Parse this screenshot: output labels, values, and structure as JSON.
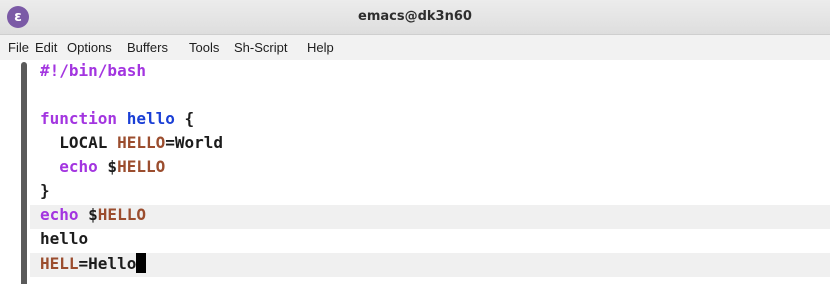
{
  "window": {
    "title": "emacs@dk3n60",
    "app_icon": "emacs-icon",
    "app_icon_glyph": "ε"
  },
  "menu": [
    "File",
    "Edit",
    "Options",
    "Buffers",
    "Tools",
    "Sh-Script",
    "Help"
  ],
  "editor": {
    "colors": {
      "keyword": "#a335e0",
      "function_name": "#1a3fd6",
      "variable": "#9b4d2e",
      "text": "#1c1c1c",
      "highlight_background": "#f0f0f0"
    },
    "lines": [
      [
        {
          "text": "#!/bin/bash",
          "role": "keyword"
        }
      ],
      [],
      [
        {
          "text": "function",
          "role": "keyword"
        },
        {
          "text": " ",
          "role": "text"
        },
        {
          "text": "hello",
          "role": "function_name"
        },
        {
          "text": " {",
          "role": "text"
        }
      ],
      [
        {
          "text": "  LOCAL ",
          "role": "text"
        },
        {
          "text": "HELLO",
          "role": "variable"
        },
        {
          "text": "=World",
          "role": "text"
        }
      ],
      [
        {
          "text": "  ",
          "role": "text"
        },
        {
          "text": "echo",
          "role": "keyword"
        },
        {
          "text": " $",
          "role": "text"
        },
        {
          "text": "HELLO",
          "role": "variable"
        }
      ],
      [
        {
          "text": "}",
          "role": "text"
        }
      ],
      [
        {
          "text": "echo",
          "role": "keyword"
        },
        {
          "text": " $",
          "role": "text"
        },
        {
          "text": "HELLO",
          "role": "variable"
        }
      ],
      [
        {
          "text": "hello",
          "role": "text"
        }
      ],
      [
        {
          "text": "HELL",
          "role": "variable"
        },
        {
          "text": "=Hello",
          "role": "text"
        }
      ]
    ],
    "highlighted_lines": [
      6,
      8
    ],
    "cursor_line": 8
  }
}
